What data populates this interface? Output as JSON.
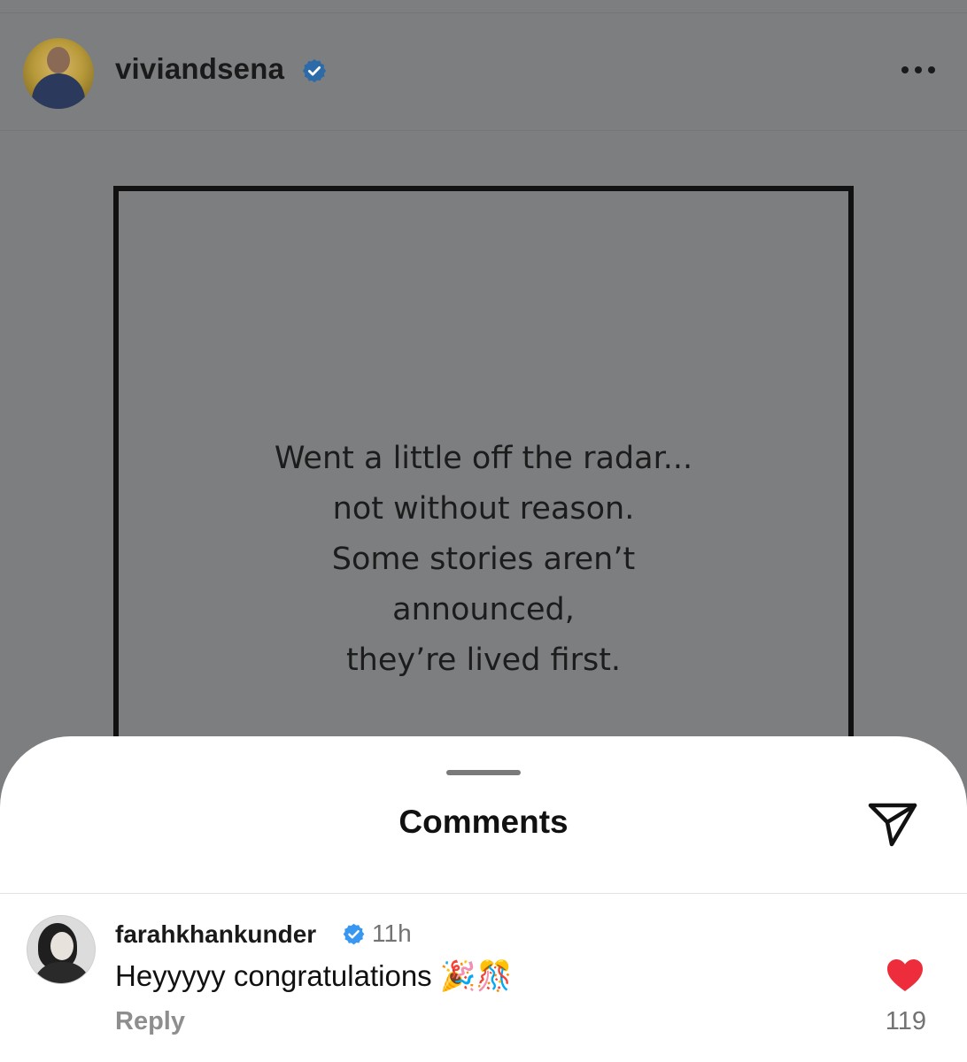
{
  "post": {
    "username": "viviandsena",
    "verified": true,
    "avatar_icon": "profile-avatar",
    "more_icon": "more-horizontal-icon",
    "text_lines": [
      "Went a little off the radar...",
      "not without reason.",
      "Some stories aren’t",
      "announced,",
      "they’re lived first."
    ]
  },
  "comments_sheet": {
    "title": "Comments",
    "share_icon": "send-icon",
    "comments": [
      {
        "username": "farahkhankunder",
        "verified": true,
        "time": "11h",
        "text": "Heyyyyy congratulations 🎉🎊",
        "reply_label": "Reply",
        "likes": "119",
        "liked": true
      }
    ]
  },
  "colors": {
    "verified_blue": "#3897f0",
    "heart_red": "#ed2d3c",
    "overlay_gray": "#7d7e80"
  }
}
